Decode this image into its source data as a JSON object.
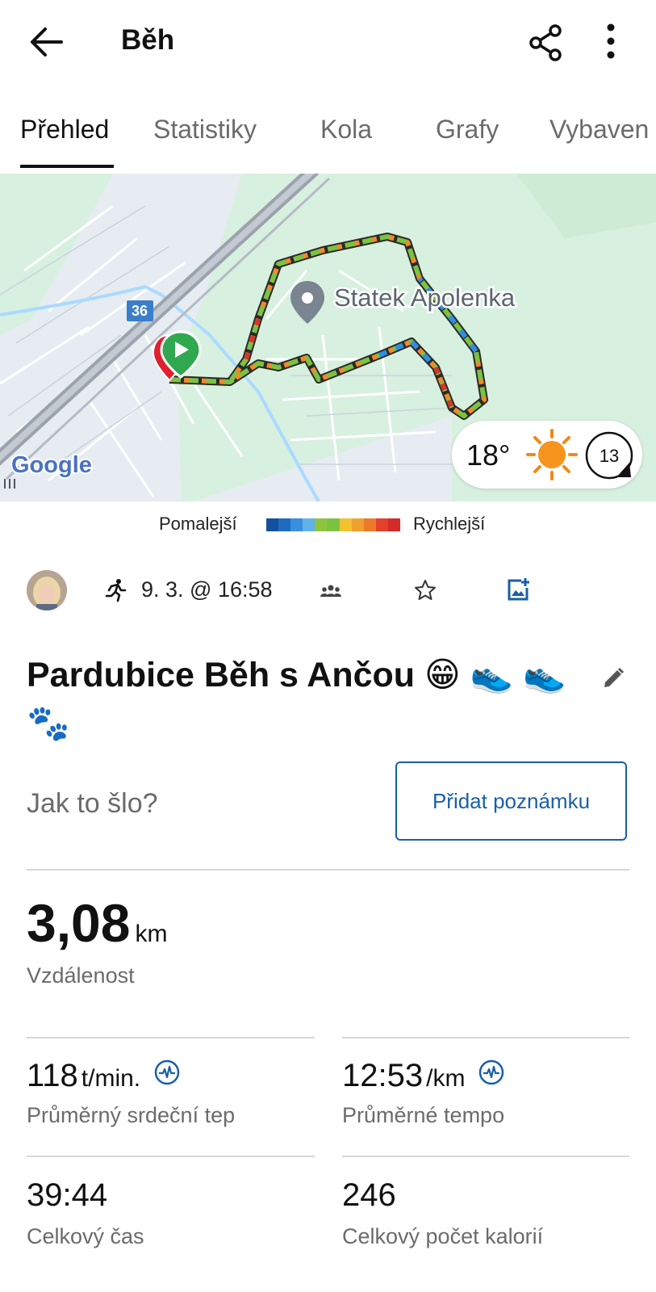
{
  "app_bar": {
    "title": "Běh",
    "back_icon": "arrow-back-icon",
    "share_icon": "share-icon",
    "more_icon": "more-vert-icon"
  },
  "tabs": [
    {
      "label": "Přehled",
      "active": true
    },
    {
      "label": "Statistiky",
      "active": false
    },
    {
      "label": "Kola",
      "active": false
    },
    {
      "label": "Grafy",
      "active": false
    },
    {
      "label": "Vybaven",
      "active": false
    }
  ],
  "map": {
    "place_label": "Statek Apolenka",
    "road_number": "36",
    "attribution": "Google",
    "weather": {
      "temperature": "18°",
      "condition_icon": "sun-icon",
      "wind_speed": "13"
    },
    "route_colors": [
      "#1d5fb0",
      "#2f8fe0",
      "#7cc242",
      "#f2c230",
      "#f08a2a",
      "#d9352a"
    ]
  },
  "legend": {
    "slower": "Pomalejší",
    "faster": "Rychlejší",
    "scale_colors": [
      "#1450a0",
      "#1d6ac0",
      "#3a8ee0",
      "#62b2ea",
      "#8ec43e",
      "#7cc242",
      "#f2c230",
      "#f0a030",
      "#ec7a28",
      "#e2402a",
      "#d42a2a"
    ]
  },
  "activity_meta": {
    "avatar": "user-avatar",
    "activity_icon": "running-icon",
    "datetime": "9. 3. @ 16:58",
    "people_icon": "people-icon",
    "favorite_icon": "star-outline-icon",
    "photo_icon": "add-photo-icon"
  },
  "activity": {
    "title": "Pardubice Běh s Ančou 😁 👟 👟 🐾",
    "edit_icon": "pencil-icon",
    "note_prompt": "Jak to šlo?",
    "add_note_button": "Přidat poznámku"
  },
  "stats": {
    "distance": {
      "value": "3,08",
      "unit": "km",
      "label": "Vzdálenost"
    },
    "heart_rate": {
      "value": "118",
      "unit": "t/min.",
      "label": "Průměrný srdeční tep"
    },
    "pace": {
      "value": "12:53",
      "unit": "/km",
      "label": "Průměrné tempo"
    },
    "total_time": {
      "value": "39:44",
      "label": "Celkový čas"
    },
    "calories": {
      "value": "246",
      "label": "Celkový počet kalorií"
    }
  },
  "colors": {
    "accent_blue": "#1a5fa8",
    "map_green": "#d8f0df",
    "map_water": "#aadaff",
    "start_green": "#2fa84f",
    "end_red": "#e0202e"
  }
}
